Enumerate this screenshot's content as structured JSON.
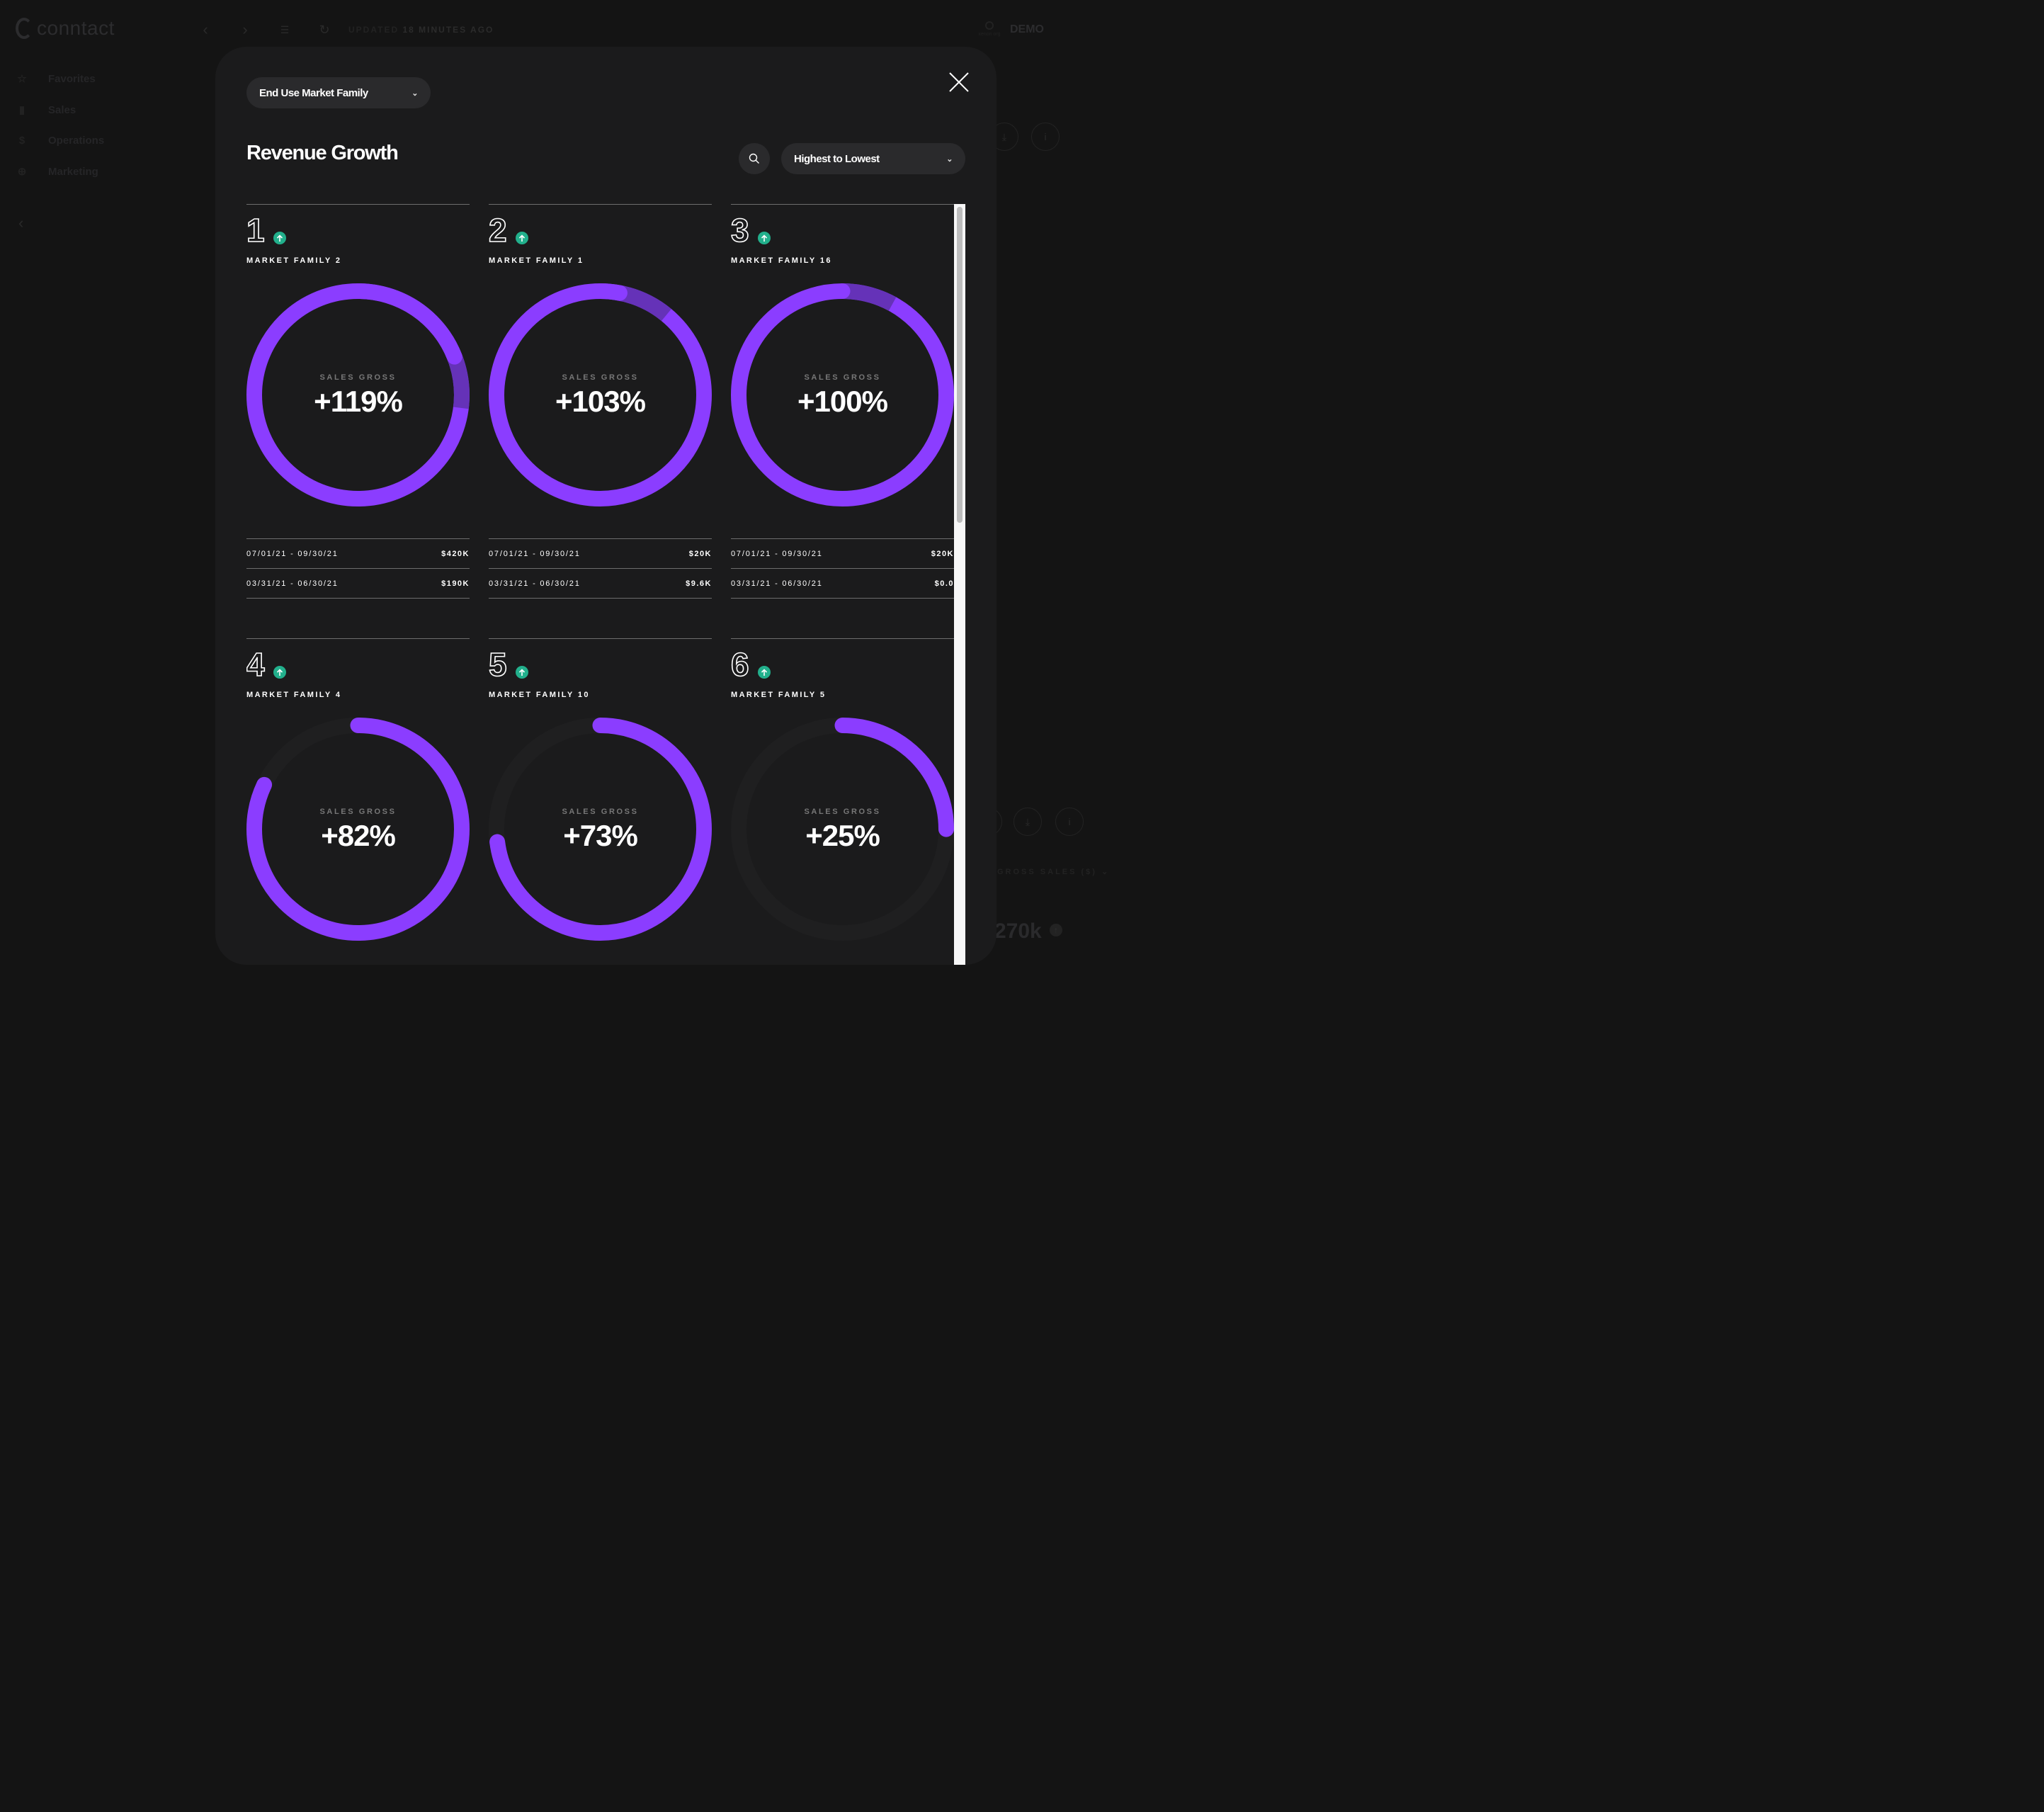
{
  "app": {
    "logo_text": "conntact",
    "updated_prefix": "UPDATED",
    "updated_value": "18 MINUTES AGO",
    "org_label": "xenon org",
    "account_label": "DEMO",
    "icons": {
      "back": "chevron-left-icon",
      "forward": "chevron-right-icon",
      "filter": "filter-icon",
      "refresh": "refresh-icon",
      "download": "download-icon",
      "info": "info-icon"
    }
  },
  "sidebar": {
    "items": [
      {
        "label": "Favorites",
        "icon": "star-icon"
      },
      {
        "label": "Sales",
        "icon": "bar-chart-icon"
      },
      {
        "label": "Operations",
        "icon": "dollar-circle-icon"
      },
      {
        "label": "Marketing",
        "icon": "target-icon"
      }
    ],
    "collapse_icon": "chevron-left-icon"
  },
  "background_widget": {
    "metric_label": "GROSS SALES ($)",
    "metric_value": "270k"
  },
  "modal": {
    "group_by_selected": "End Use Market Family",
    "title": "Revenue Growth",
    "sort_selected": "Highest to Lowest",
    "accent_color": "#8b3dff",
    "up_color": "#22b08c",
    "cards": [
      {
        "rank": "1",
        "trend": "up",
        "name": "MARKET FAMILY 2",
        "metric_label": "SALES GROSS",
        "value_text": "+119%",
        "growth_pct": 119,
        "rows": [
          {
            "period": "07/01/21 - 09/30/21",
            "amount": "$420K"
          },
          {
            "period": "03/31/21 - 06/30/21",
            "amount": "$190K"
          }
        ]
      },
      {
        "rank": "2",
        "trend": "up",
        "name": "MARKET FAMILY 1",
        "metric_label": "SALES GROSS",
        "value_text": "+103%",
        "growth_pct": 103,
        "rows": [
          {
            "period": "07/01/21 - 09/30/21",
            "amount": "$20K"
          },
          {
            "period": "03/31/21 - 06/30/21",
            "amount": "$9.6K"
          }
        ]
      },
      {
        "rank": "3",
        "trend": "up",
        "name": "MARKET FAMILY 16",
        "metric_label": "SALES GROSS",
        "value_text": "+100%",
        "growth_pct": 100,
        "rows": [
          {
            "period": "07/01/21 - 09/30/21",
            "amount": "$20K"
          },
          {
            "period": "03/31/21 - 06/30/21",
            "amount": "$0.0"
          }
        ]
      },
      {
        "rank": "4",
        "trend": "up",
        "name": "MARKET FAMILY 4",
        "metric_label": "SALES GROSS",
        "value_text": "+82%",
        "growth_pct": 82,
        "rows": []
      },
      {
        "rank": "5",
        "trend": "up",
        "name": "MARKET FAMILY 10",
        "metric_label": "SALES GROSS",
        "value_text": "+73%",
        "growth_pct": 73,
        "rows": []
      },
      {
        "rank": "6",
        "trend": "up",
        "name": "MARKET FAMILY 5",
        "metric_label": "SALES GROSS",
        "value_text": "+25%",
        "growth_pct": 25,
        "rows": []
      }
    ],
    "scroll_position_fraction": 0
  }
}
